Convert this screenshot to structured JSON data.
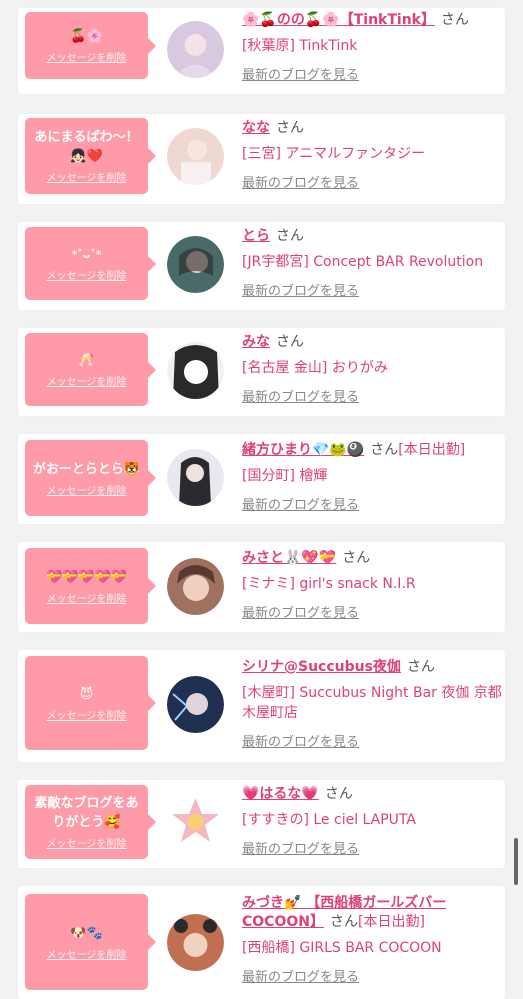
{
  "common": {
    "delete_label": "メッセージを削除",
    "san": "さん",
    "blog_label": "最新のブログを見る"
  },
  "colors": {
    "bubble": "#ff9aa8",
    "name": "#e0407a",
    "background": "#f2f2f2"
  },
  "items": [
    {
      "message": "🍒🌸",
      "name": "🌸🍒のの🍒🌸【TinkTink】",
      "suffix": "",
      "shop": "[秋葉原] TinkTink",
      "avatar_color": "#d8c8e0"
    },
    {
      "message": "あにまるぱわ〜！👧🏻❤️",
      "name": "なな",
      "suffix": "",
      "shop": "[三宮] アニマルファンタジー",
      "avatar_color": "#f0d8d0"
    },
    {
      "message": "*˚ᴗ˚*",
      "name": "とら",
      "suffix": "",
      "shop": "[JR宇都宮] Concept BAR Revolution",
      "avatar_color": "#4a6a6a"
    },
    {
      "message": "🥂",
      "name": "みな",
      "suffix": "",
      "shop": "[名古屋 金山] おりがみ",
      "avatar_color": "#2a2a2a"
    },
    {
      "message": "がおーとらとら🐯",
      "name": "緒方ひまり💎🐸🎱",
      "suffix": "[本日出勤]",
      "shop": "[国分町] 檜輝",
      "avatar_color": "#e8e8f0"
    },
    {
      "message": "💝💝💝💝💝",
      "name": "みさと🐰💖💝",
      "suffix": "",
      "shop": "[ミナミ] girl's snack N.I.R",
      "avatar_color": "#a07060"
    },
    {
      "message": "😈",
      "name": "シリナ@Succubus夜伽",
      "suffix": "",
      "shop": "[木屋町] Succubus Night Bar 夜伽 京都木屋町店",
      "avatar_color": "#203050"
    },
    {
      "message": "素敵なブログをありがとう🥰",
      "name": "💗はるな💗",
      "suffix": "",
      "shop": "[すすきの] Le ciel LAPUTA",
      "avatar_color": "#f5b8c0"
    },
    {
      "message": "🐶🐾",
      "name": "みづき💅 【西船橋ガールズバーCOCOON】",
      "suffix": "[本日出勤]",
      "shop": "[西船橋] GIRLS BAR COCOON",
      "avatar_color": "#c07050"
    }
  ]
}
